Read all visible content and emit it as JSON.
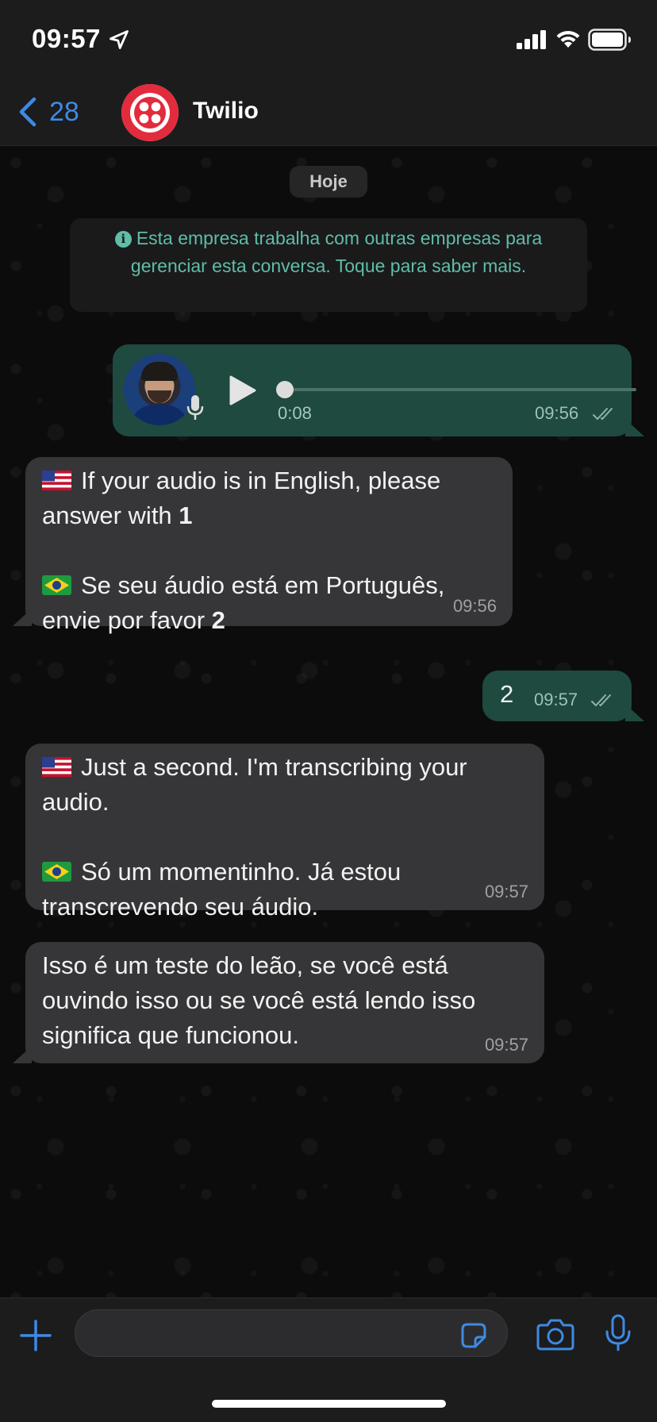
{
  "status_bar": {
    "time": "09:57",
    "location_icon": "location-arrow-icon",
    "signal_icon": "cellular-signal-icon",
    "wifi_icon": "wifi-icon",
    "battery_icon": "battery-icon"
  },
  "header": {
    "back_count": "28",
    "back_icon": "chevron-left-icon",
    "contact_name": "Twilio",
    "accent_color": "#3e8ae3",
    "avatar_color": "#e22b3c"
  },
  "chat": {
    "date_label": "Hoje",
    "notice": "Esta empresa trabalha com outras empresas para gerenciar esta conversa. Toque para saber mais.",
    "audio_message": {
      "duration": "0:08",
      "time": "09:56",
      "progress": 0
    },
    "msg_language_prompt": {
      "en_text": "If your audio is in English, please answer with ",
      "en_bold": "1",
      "pt_text": "Se seu áudio está em Português, envie por favor ",
      "pt_bold": "2",
      "time": "09:56"
    },
    "msg_reply": {
      "text": "2",
      "time": "09:57"
    },
    "msg_wait": {
      "en_text": "Just a second. I'm transcribing your audio.",
      "pt_text": "Só um momentinho. Já estou transcrevendo seu áudio.",
      "time": "09:57"
    },
    "msg_transcript": {
      "text": "Isso é um teste do leão, se você está ouvindo isso ou se você está lendo isso significa que funcionou.",
      "time": "09:57"
    },
    "colors": {
      "incoming_bubble": "#363638",
      "outgoing_bubble": "#1e4a40",
      "notice_text": "#5fbda9"
    }
  },
  "input_bar": {
    "placeholder": "",
    "plus_icon": "plus-icon",
    "sticker_icon": "sticker-icon",
    "camera_icon": "camera-icon",
    "mic_icon": "microphone-icon"
  }
}
